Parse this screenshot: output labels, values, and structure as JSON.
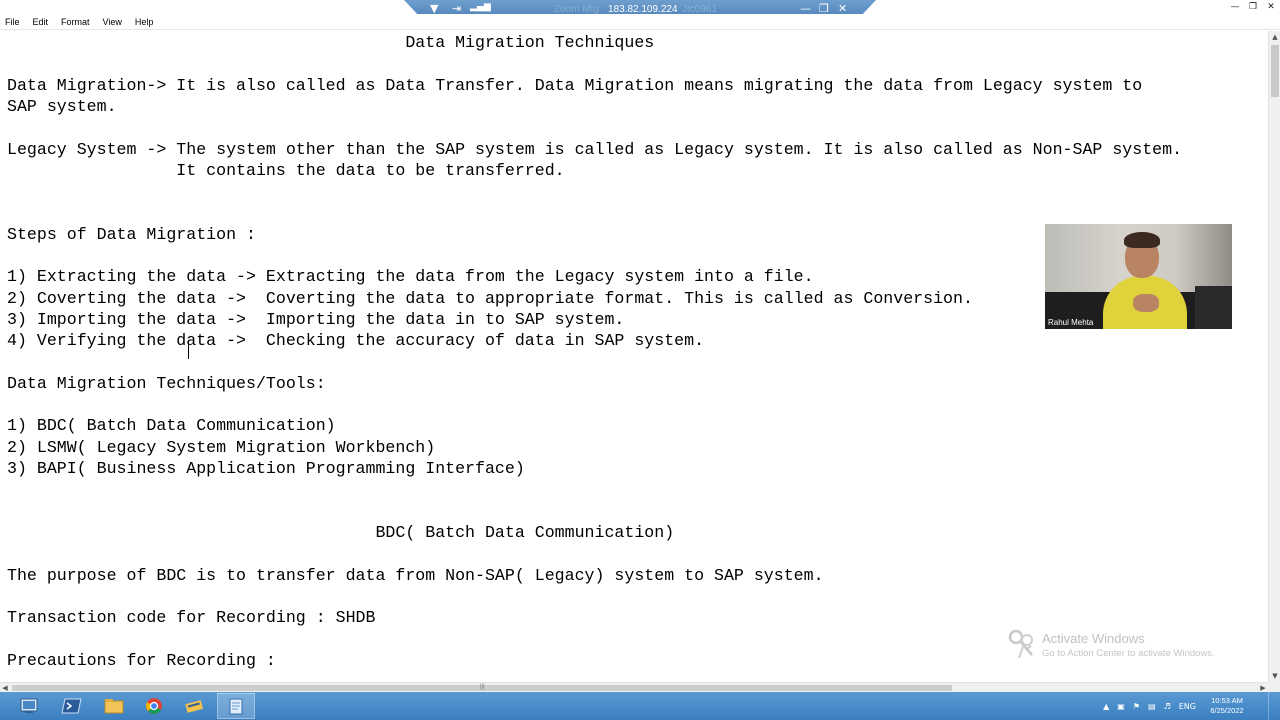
{
  "remote_bar": {
    "host": "183.82.109.224",
    "faded_left": "Zoom Mtg",
    "faded_right": "Jtc0961"
  },
  "menu": [
    "File",
    "Edit",
    "Format",
    "View",
    "Help"
  ],
  "document": {
    "lines": [
      "                                        Data Migration Techniques",
      "",
      "Data Migration-> It is also called as Data Transfer. Data Migration means migrating the data from Legacy system to",
      "SAP system.",
      "",
      "Legacy System -> The system other than the SAP system is called as Legacy system. It is also called as Non-SAP system.",
      "                 It contains the data to be transferred.",
      "",
      "",
      "Steps of Data Migration :",
      "",
      "1) Extracting the data -> Extracting the data from the Legacy system into a file.",
      "2) Coverting the data ->  Coverting the data to appropriate format. This is called as Conversion.",
      "3) Importing the data ->  Importing the data in to SAP system.",
      "4) Verifying the data ->  Checking the accuracy of data in SAP system.",
      "",
      "Data Migration Techniques/Tools:",
      "",
      "1) BDC( Batch Data Communication)",
      "2) LSMW( Legacy System Migration Workbench)",
      "3) BAPI( Business Application Programming Interface)",
      "",
      "",
      "                                     BDC( Batch Data Communication)",
      "",
      "The purpose of BDC is to transfer data from Non-SAP( Legacy) system to SAP system.",
      "",
      "Transaction code for Recording : SHDB",
      "",
      "Precautions for Recording :"
    ]
  },
  "webcam": {
    "participant_name": "Rahul Mehta"
  },
  "watermark": {
    "title": "Activate Windows",
    "subtitle": "Go to Action Center to activate Windows."
  },
  "taskbar": {
    "language": "ENG",
    "time": "10:53 AM",
    "date": "6/25/2022",
    "apps": [
      "server-manager-icon",
      "powershell-icon",
      "file-explorer-icon",
      "chrome-icon",
      "app-icon",
      "notepad-icon"
    ]
  }
}
